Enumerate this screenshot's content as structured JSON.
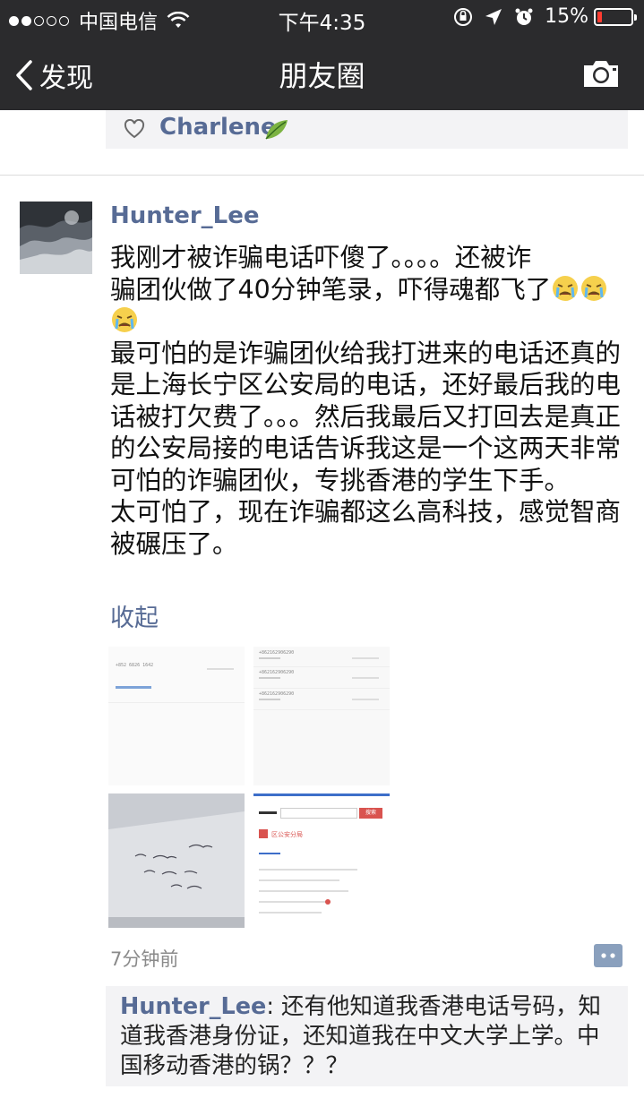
{
  "status_bar": {
    "carrier": "中国电信",
    "time": "下午4:35",
    "battery": "15%",
    "battery_level": 0.15
  },
  "nav": {
    "back_label": "发现",
    "title": "朋友圈"
  },
  "likes": {
    "names": "Charlene"
  },
  "post": {
    "username": "Hunter_Lee",
    "line1": "我刚才被诈骗电话吓傻了。。。。还被诈",
    "line2": "骗团伙做了40分钟笔录，吓得魂都飞了",
    "para2": "最可怕的是诈骗团伙给我打进来的电话还真的是上海长宁区公安局的电话，还好最后我的电话被打欠费了。。。然后我最后又打回去是真正的公安局接的电话告诉我这是一个这两天非常可怕的诈骗团伙，专挑香港的学生下手。",
    "para3": "太可怕了，现在诈骗都这么高科技，感觉智商被碾压了。",
    "collapse_label": "收起",
    "time_ago": "7分钟前",
    "photos": {
      "p1_number": "+852 6826 1642",
      "p2_numbers": [
        "+862162906290",
        "+862162906290",
        "+862162906290"
      ],
      "p4_label": "区公安分局",
      "p4_button": "搜索"
    }
  },
  "comment": {
    "author": "Hunter_Lee",
    "text": ": 还有他知道我香港电话号码，知道我香港身份证，还知道我在中文大学上学。中国移动香港的锅？？？"
  }
}
